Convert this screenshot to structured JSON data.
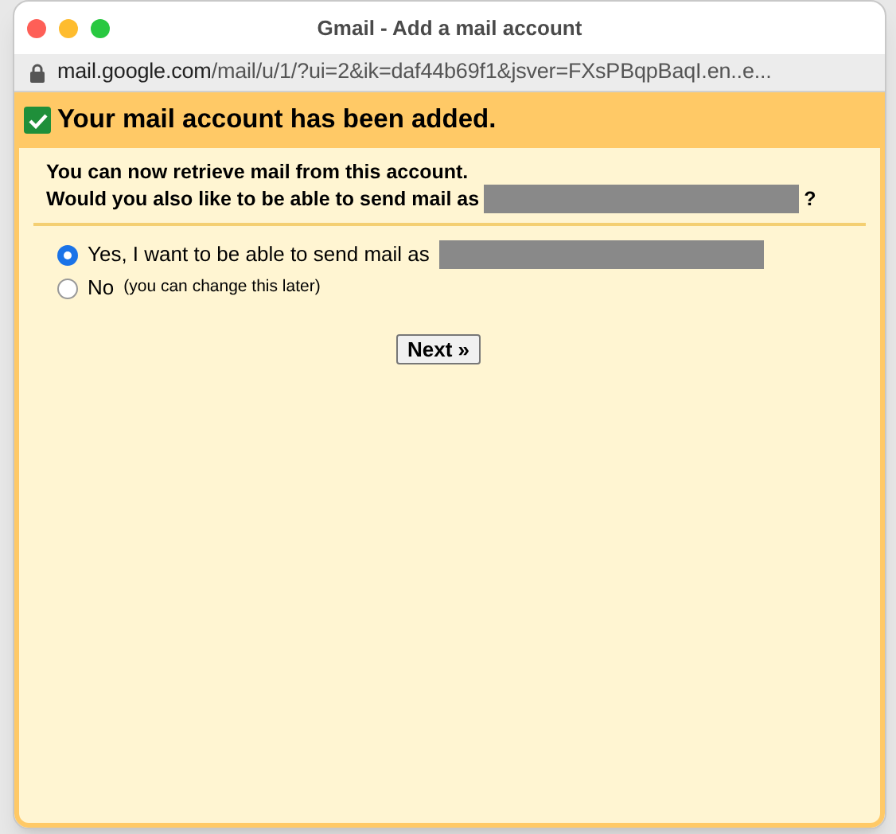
{
  "window": {
    "title": "Gmail - Add a mail account"
  },
  "address_bar": {
    "domain": "mail.google.com",
    "path": "/mail/u/1/?ui=2&ik=daf44b69f1&jsver=FXsPBqpBaqI.en..e..."
  },
  "banner": {
    "checked": true,
    "title": "Your mail account has been added."
  },
  "intro": {
    "line_1": "You can now retrieve mail from this account.",
    "line_2": "Would you also like to be able to send mail as",
    "line_2_end": "?"
  },
  "options": [
    {
      "label": "Yes, I want to be able to send mail as",
      "selected": true,
      "redacted": true
    },
    {
      "label": "No",
      "note": "(you can change this later)",
      "selected": false,
      "redacted": false
    }
  ],
  "next_button": {
    "label": "Next »"
  }
}
